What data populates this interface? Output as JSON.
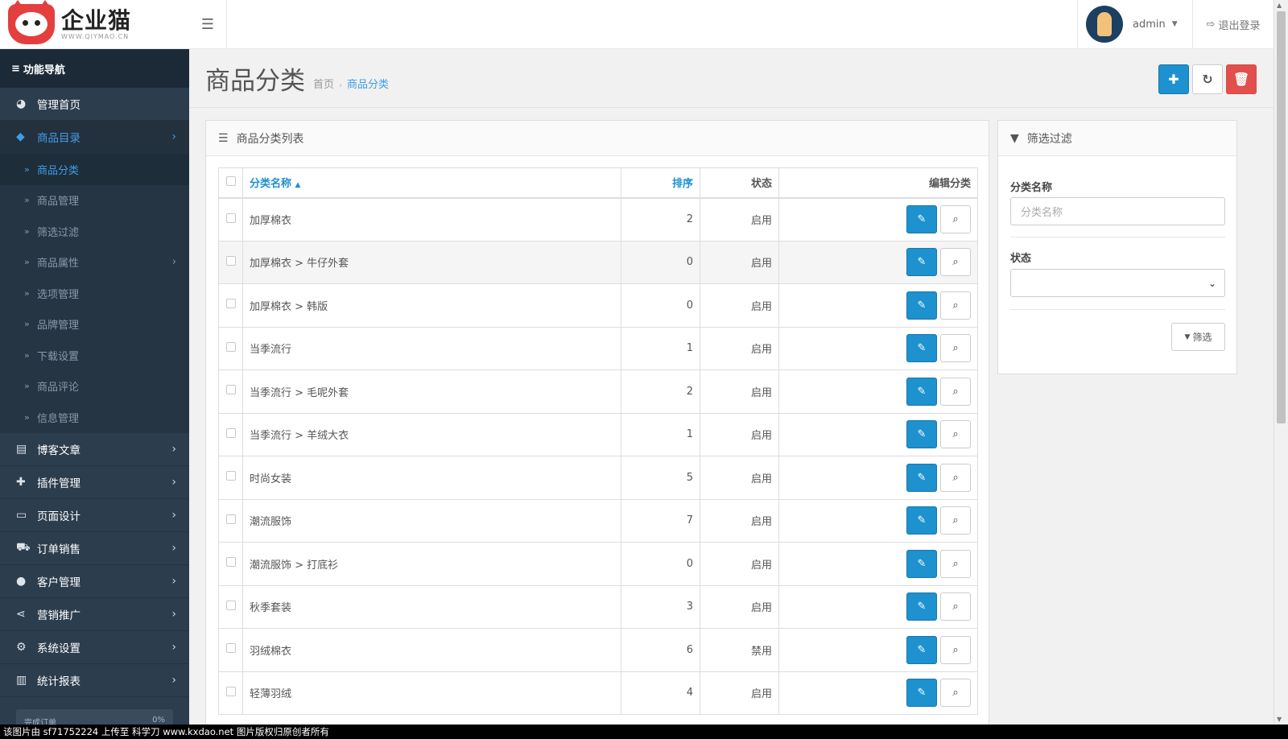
{
  "brand": {
    "name": "企业猫",
    "sub": "WWW.QIYMAO.CN"
  },
  "topbar": {
    "user": "admin",
    "logout": "退出登录"
  },
  "sidebar": {
    "header": "功能导航",
    "items": [
      {
        "label": "管理首页",
        "icon": "dashboard-icon"
      },
      {
        "label": "商品目录",
        "icon": "tags-icon",
        "active": true
      },
      {
        "label": "博客文章",
        "icon": "newspaper-icon"
      },
      {
        "label": "插件管理",
        "icon": "puzzle-icon"
      },
      {
        "label": "页面设计",
        "icon": "desktop-icon"
      },
      {
        "label": "订单销售",
        "icon": "cart-icon"
      },
      {
        "label": "客户管理",
        "icon": "user-icon"
      },
      {
        "label": "营销推广",
        "icon": "share-icon"
      },
      {
        "label": "系统设置",
        "icon": "gear-icon"
      },
      {
        "label": "统计报表",
        "icon": "bar-chart-icon"
      }
    ],
    "sub_items": [
      "商品分类",
      "商品管理",
      "筛选过滤",
      "商品属性",
      "选项管理",
      "品牌管理",
      "下载设置",
      "商品评论",
      "信息管理"
    ],
    "progress": {
      "label": "完成订单",
      "value": "0%"
    }
  },
  "page": {
    "title": "商品分类",
    "breadcrumb": [
      "首页",
      "商品分类"
    ]
  },
  "list_panel": {
    "title": "商品分类列表",
    "headers": {
      "name": "分类名称",
      "sort": "排序",
      "status": "状态",
      "action": "编辑分类"
    },
    "rows": [
      {
        "name": "加厚棉衣",
        "sort": "2",
        "status": "启用"
      },
      {
        "name": "加厚棉衣  >  牛仔外套",
        "sort": "0",
        "status": "启用"
      },
      {
        "name": "加厚棉衣  >  韩版",
        "sort": "0",
        "status": "启用"
      },
      {
        "name": "当季流行",
        "sort": "1",
        "status": "启用"
      },
      {
        "name": "当季流行  >  毛呢外套",
        "sort": "2",
        "status": "启用"
      },
      {
        "name": "当季流行  >  羊绒大衣",
        "sort": "1",
        "status": "启用"
      },
      {
        "name": "时尚女装",
        "sort": "5",
        "status": "启用"
      },
      {
        "name": "潮流服饰",
        "sort": "7",
        "status": "启用"
      },
      {
        "name": "潮流服饰  >  打底衫",
        "sort": "0",
        "status": "启用"
      },
      {
        "name": "秋季套装",
        "sort": "3",
        "status": "启用"
      },
      {
        "name": "羽绒棉衣",
        "sort": "6",
        "status": "禁用"
      },
      {
        "name": "轻薄羽绒",
        "sort": "4",
        "status": "启用"
      }
    ]
  },
  "filter_panel": {
    "title": "筛选过滤",
    "name_label": "分类名称",
    "name_placeholder": "分类名称",
    "status_label": "状态",
    "status_value": "",
    "button": "筛选"
  },
  "watermark": "该图片由  sf71752224  上传至  科学刀  www.kxdao.net  图片版权归原创者所有",
  "colors": {
    "accent": "#1e91cf",
    "danger": "#e2504c",
    "sidebar": "#2c3d4e"
  }
}
